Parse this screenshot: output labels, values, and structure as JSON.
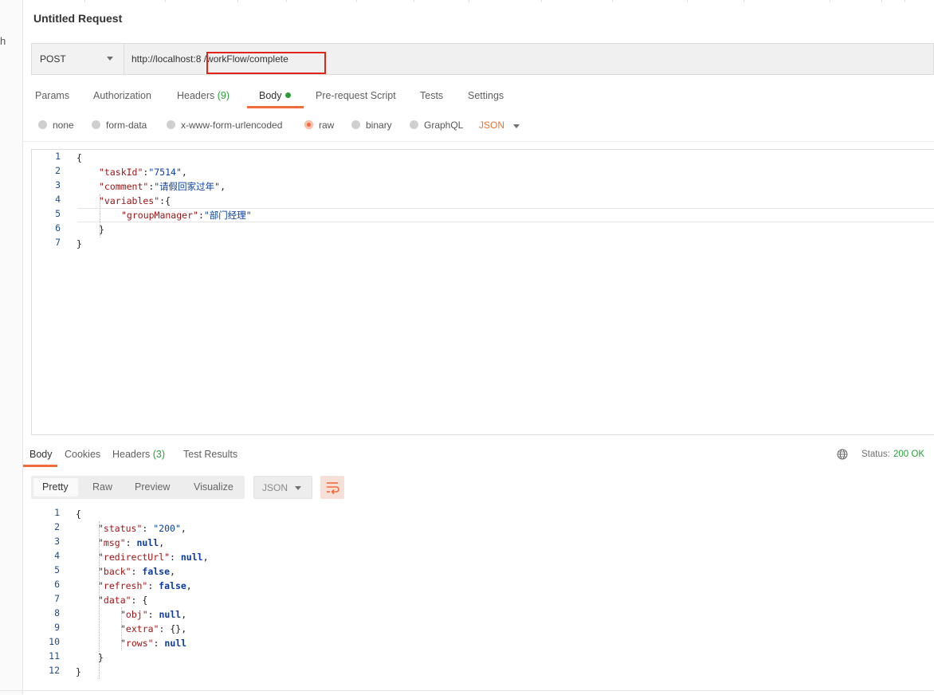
{
  "left_strip": {
    "fragment": "h"
  },
  "request": {
    "title": "Untitled Request",
    "method": "POST",
    "url": "http://localhost:8 /workFlow/complete"
  },
  "request_tabs": {
    "params": "Params",
    "authorization": "Authorization",
    "headers": "Headers",
    "headers_count": "(9)",
    "body": "Body",
    "pre_request": "Pre-request Script",
    "tests": "Tests",
    "settings": "Settings"
  },
  "body_types": {
    "none": "none",
    "form_data": "form-data",
    "urlencoded": "x-www-form-urlencoded",
    "raw": "raw",
    "binary": "binary",
    "graphql": "GraphQL",
    "format": "JSON",
    "selected": "raw"
  },
  "request_body": {
    "line_numbers": [
      "1",
      "2",
      "3",
      "4",
      "5",
      "6",
      "7"
    ],
    "open_brace": "{",
    "task_key": "\"taskId\"",
    "task_val": "\"7514\"",
    "comment_key": "\"comment\"",
    "comment_val": "\"请假回家过年\"",
    "variables_key": "\"variables\"",
    "group_key": "\"groupManager\"",
    "group_val": "\"部门经理\"",
    "inner_close": "}",
    "close_brace": "}"
  },
  "response_tabs": {
    "body": "Body",
    "cookies": "Cookies",
    "headers": "Headers",
    "headers_count": "(3)",
    "test_results": "Test Results"
  },
  "status": {
    "label": "Status:",
    "value": "200 OK"
  },
  "view_modes": {
    "pretty": "Pretty",
    "raw": "Raw",
    "preview": "Preview",
    "visualize": "Visualize",
    "format": "JSON"
  },
  "response_body": {
    "line_numbers": [
      "1",
      "2",
      "3",
      "4",
      "5",
      "6",
      "7",
      "8",
      "9",
      "10",
      "11",
      "12"
    ],
    "open_brace": "{",
    "status_key": "\"status\"",
    "status_val": "\"200\"",
    "msg_key": "\"msg\"",
    "redirect_key": "\"redirectUrl\"",
    "back_key": "\"back\"",
    "refresh_key": "\"refresh\"",
    "data_key": "\"data\"",
    "obj_key": "\"obj\"",
    "extra_key": "\"extra\"",
    "extra_val": "{}",
    "rows_key": "\"rows\"",
    "null_word": "null",
    "false_word": "false",
    "inner_close": "}",
    "close_brace": "}"
  },
  "colors": {
    "accent": "#f26b3a",
    "success": "#2a9d3a",
    "highlight_box": "#e0251b"
  }
}
